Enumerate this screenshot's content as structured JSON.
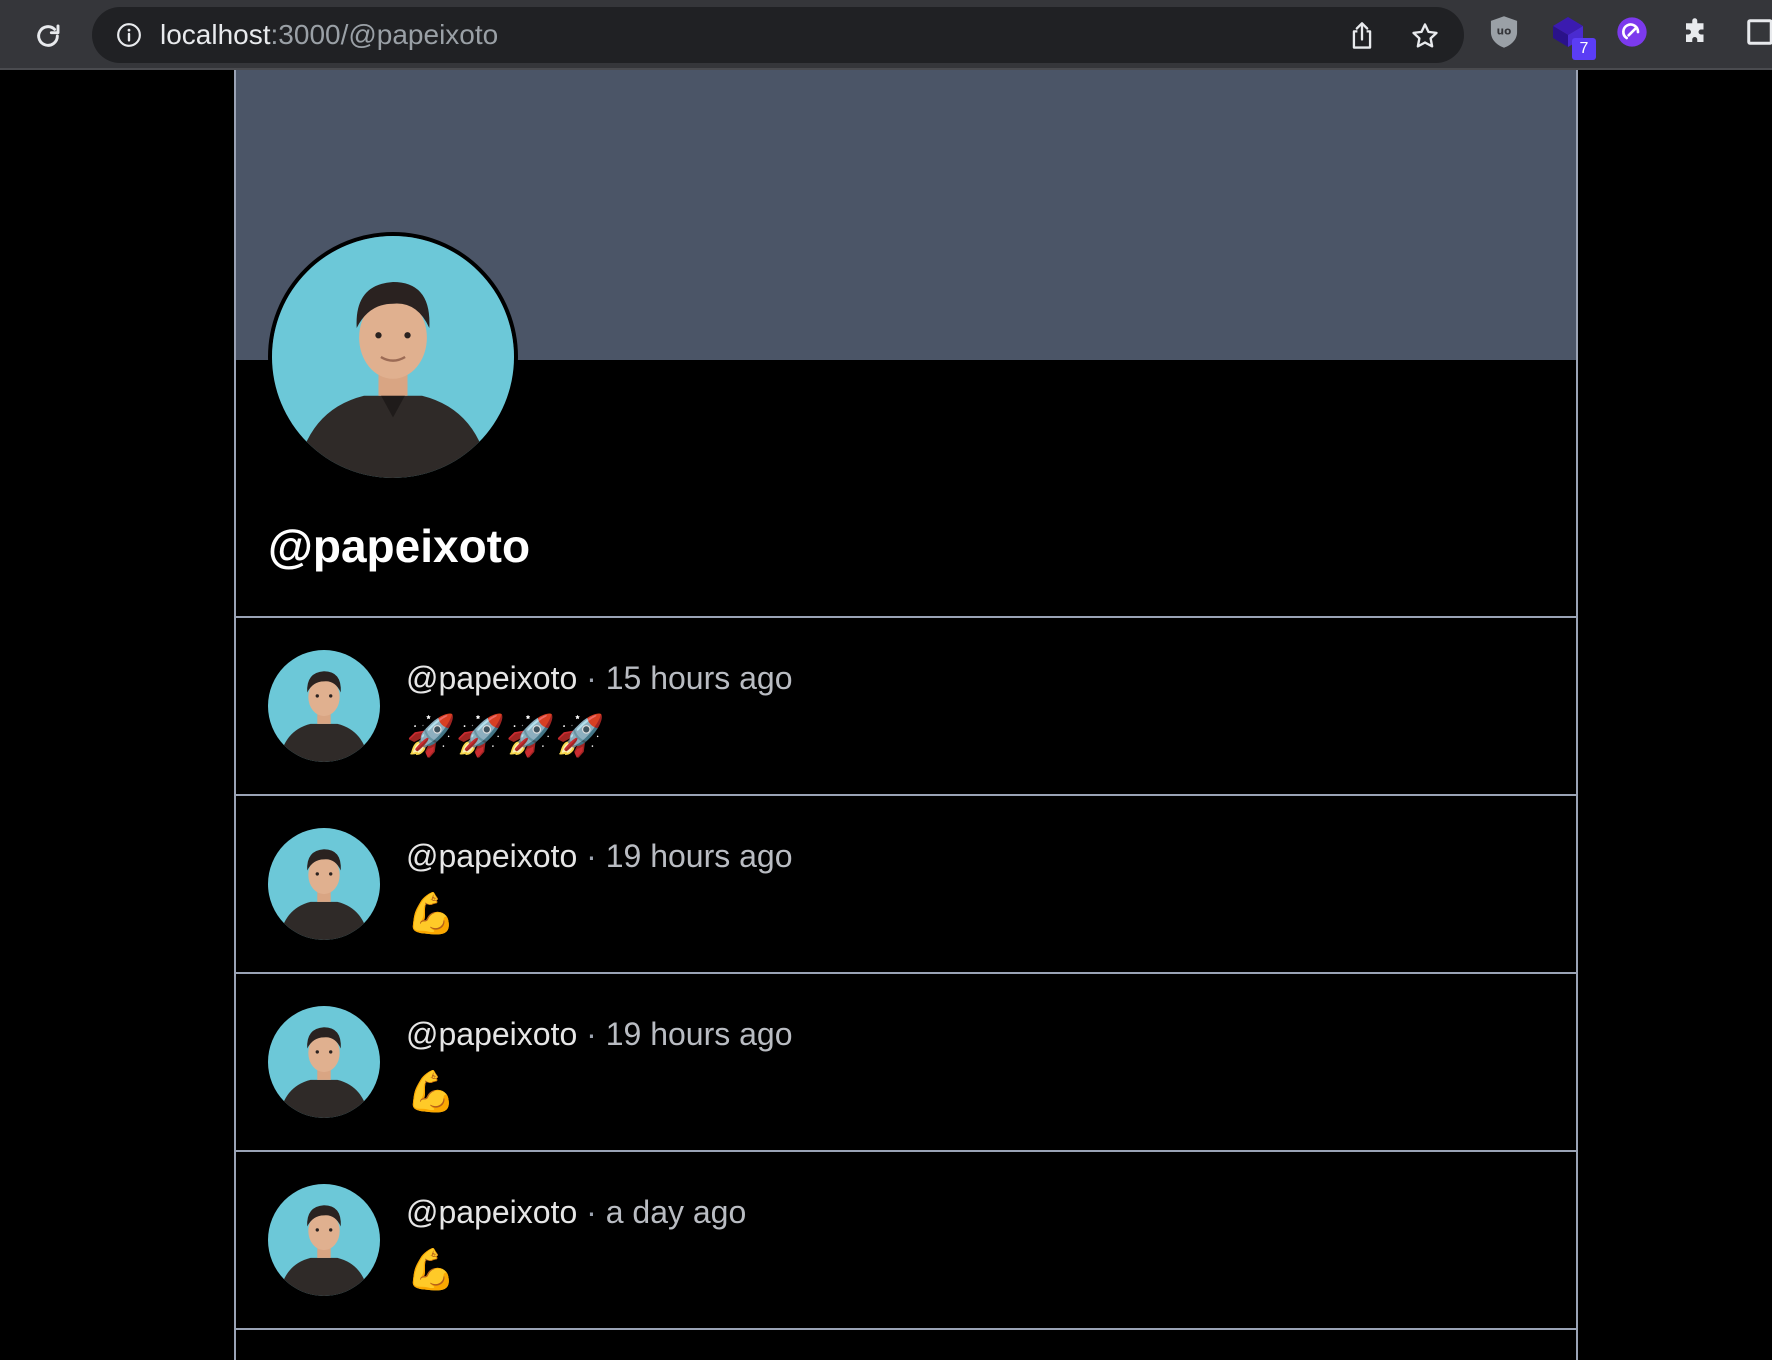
{
  "browser": {
    "url_host": "localhost",
    "url_path": ":3000/@papeixoto",
    "extension_badge": "7"
  },
  "colors": {
    "banner": "#4b5567",
    "avatar_background": "#6cc8d8",
    "divider": "#9aa3b5",
    "extension_purple": "#5b3df5"
  },
  "profile": {
    "handle": "@papeixoto"
  },
  "posts": [
    {
      "user": "@papeixoto",
      "separator": "·",
      "time": "15 hours ago",
      "content": "🚀🚀🚀🚀"
    },
    {
      "user": "@papeixoto",
      "separator": "·",
      "time": "19 hours ago",
      "content": "💪"
    },
    {
      "user": "@papeixoto",
      "separator": "·",
      "time": "19 hours ago",
      "content": "💪"
    },
    {
      "user": "@papeixoto",
      "separator": "·",
      "time": "a day ago",
      "content": "💪"
    }
  ]
}
